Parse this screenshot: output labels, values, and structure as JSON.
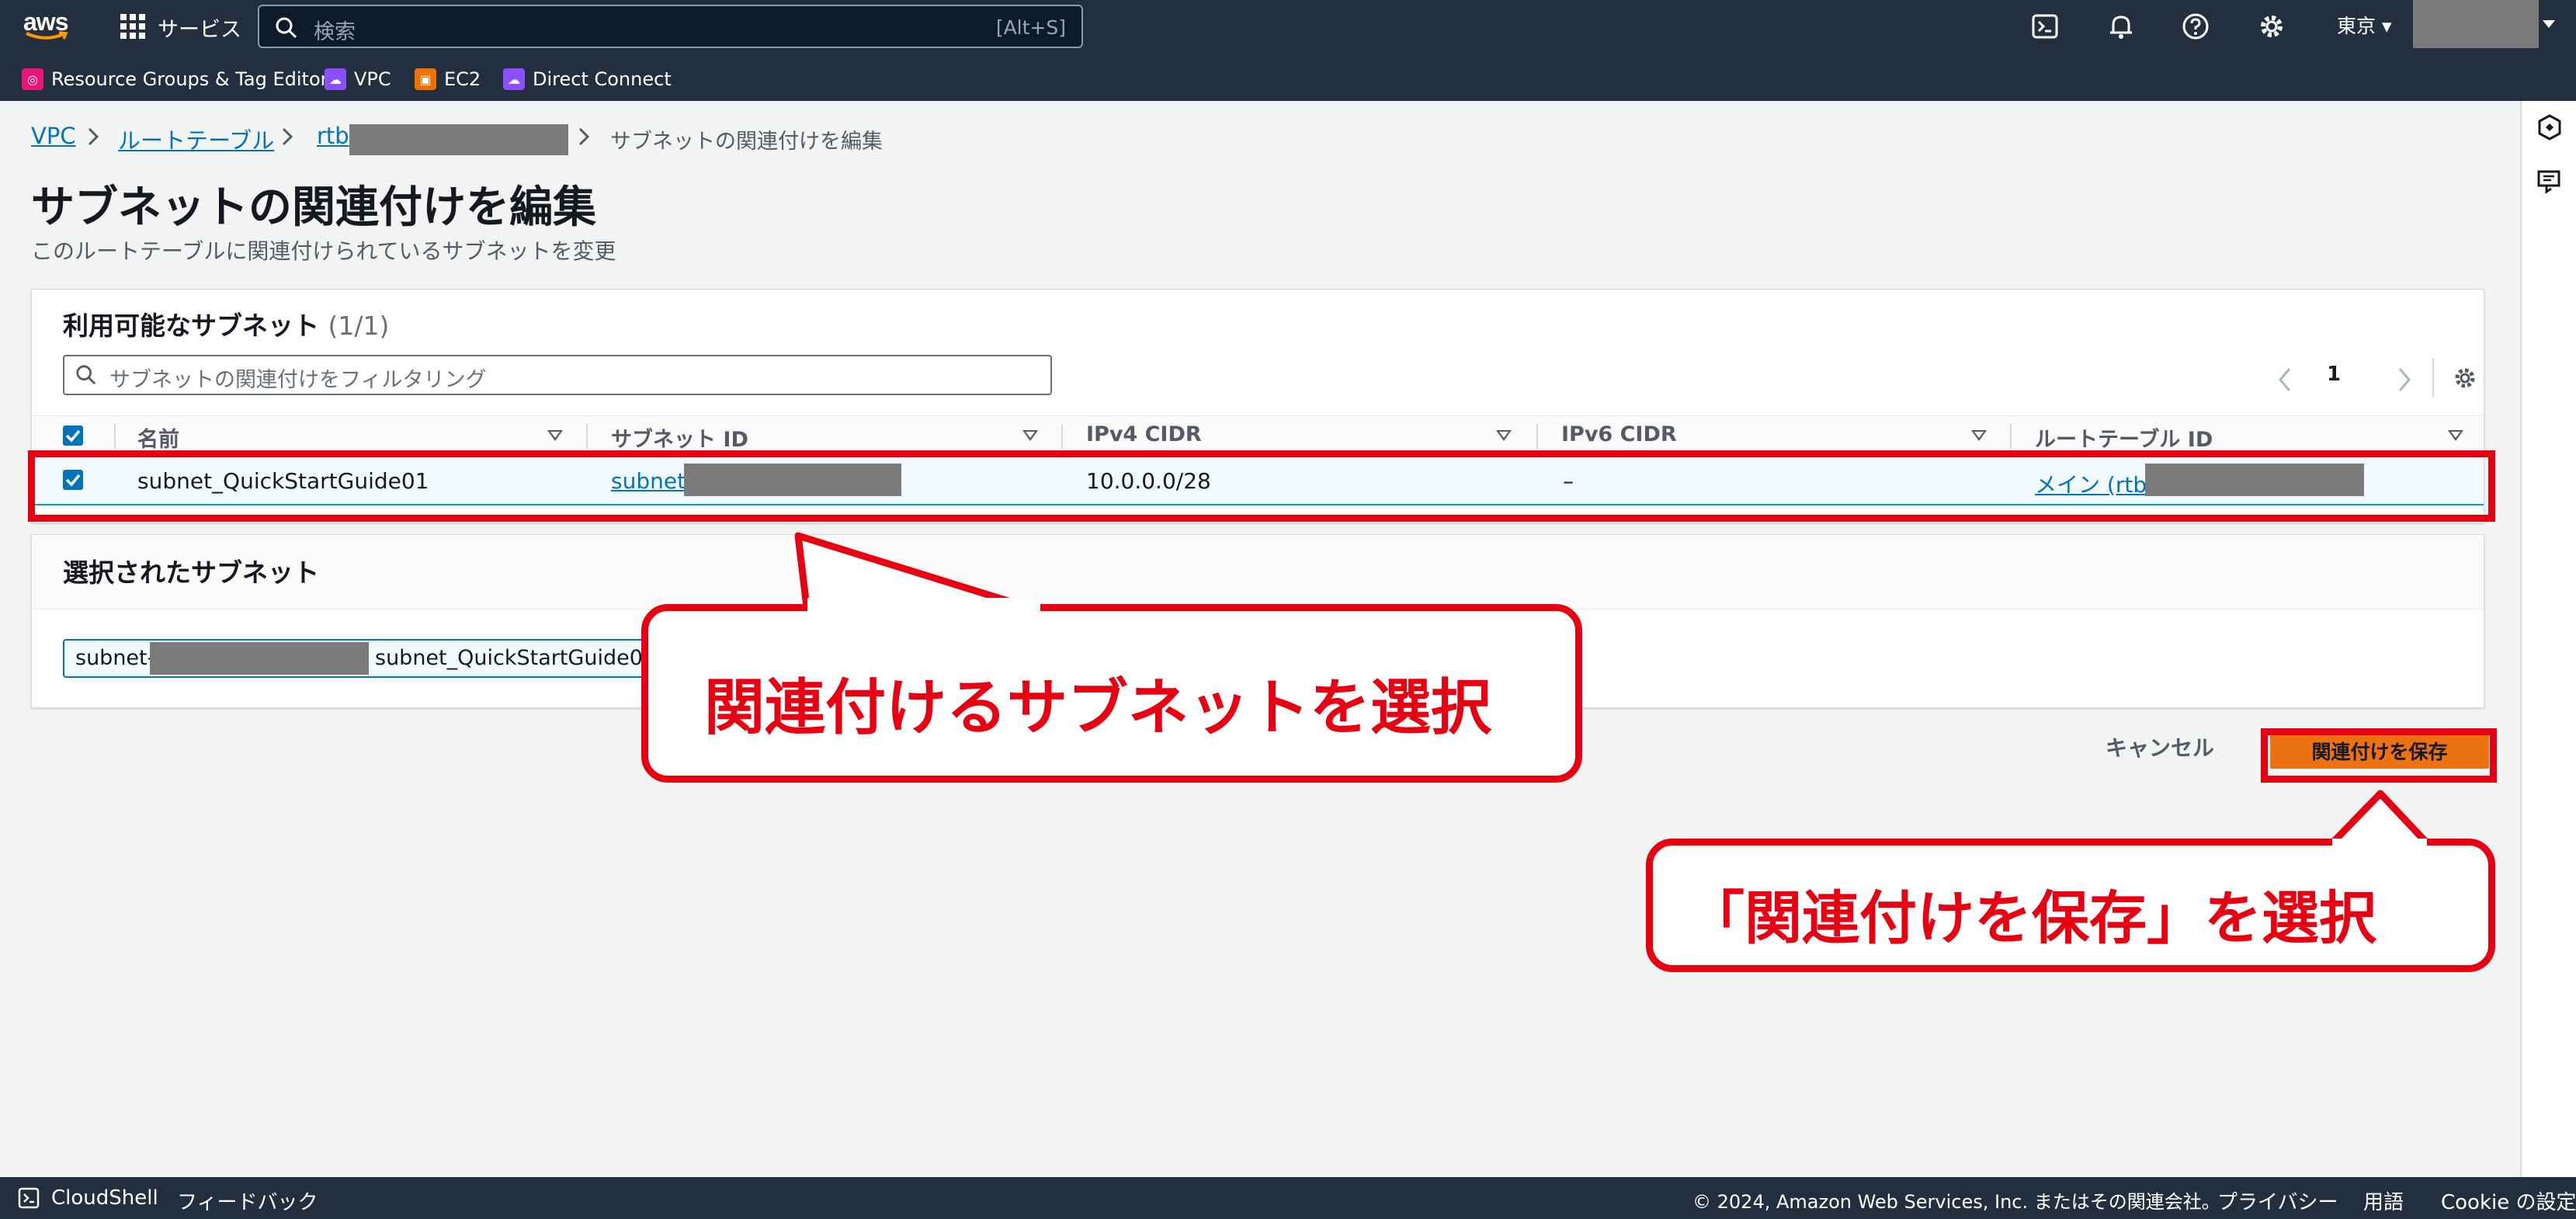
{
  "topnav": {
    "logo": "aws",
    "services_label": "サービス",
    "search_placeholder": "検索",
    "search_shortcut": "[Alt+S]",
    "region": "東京",
    "favorites": [
      {
        "label": "Resource Groups & Tag Editor",
        "icon": "resource-groups-icon",
        "color": "#e7157b"
      },
      {
        "label": "VPC",
        "icon": "vpc-icon",
        "color": "#8c4fff"
      },
      {
        "label": "EC2",
        "icon": "ec2-icon",
        "color": "#ed7100"
      },
      {
        "label": "Direct Connect",
        "icon": "direct-connect-icon",
        "color": "#8c4fff"
      }
    ]
  },
  "breadcrumb": {
    "items": [
      "VPC",
      "ルートテーブル",
      "rtb"
    ],
    "current": "サブネットの関連付けを編集"
  },
  "page": {
    "title": "サブネットの関連付けを編集",
    "description": "このルートテーブルに関連付けられているサブネットを変更"
  },
  "available": {
    "title": "利用可能なサブネット",
    "count": "(1/1)",
    "filter_placeholder": "サブネットの関連付けをフィルタリング",
    "page": "1",
    "columns": [
      "名前",
      "サブネット ID",
      "IPv4 CIDR",
      "IPv6 CIDR",
      "ルートテーブル ID"
    ],
    "rows": [
      {
        "checked": true,
        "name": "subnet_QuickStartGuide01",
        "subnet_id": "subnet-",
        "ipv4": "10.0.0.0/28",
        "ipv6": "–",
        "route_table": "メイン (rtb-"
      }
    ]
  },
  "selected": {
    "title": "選択されたサブネット",
    "token_id": "subnet-",
    "token_name": "subnet_QuickStartGuide01"
  },
  "actions": {
    "cancel": "キャンセル",
    "save": "関連付けを保存"
  },
  "annotations": {
    "callout1": "関連付けるサブネットを選択",
    "callout2": "「関連付けを保存」を選択",
    "color": "#e60012"
  },
  "footer": {
    "cloudshell": "CloudShell",
    "feedback": "フィードバック",
    "copyright": "© 2024, Amazon Web Services, Inc. またはその関連会社。",
    "privacy": "プライバシー",
    "terms": "用語",
    "cookie": "Cookie の設定"
  }
}
